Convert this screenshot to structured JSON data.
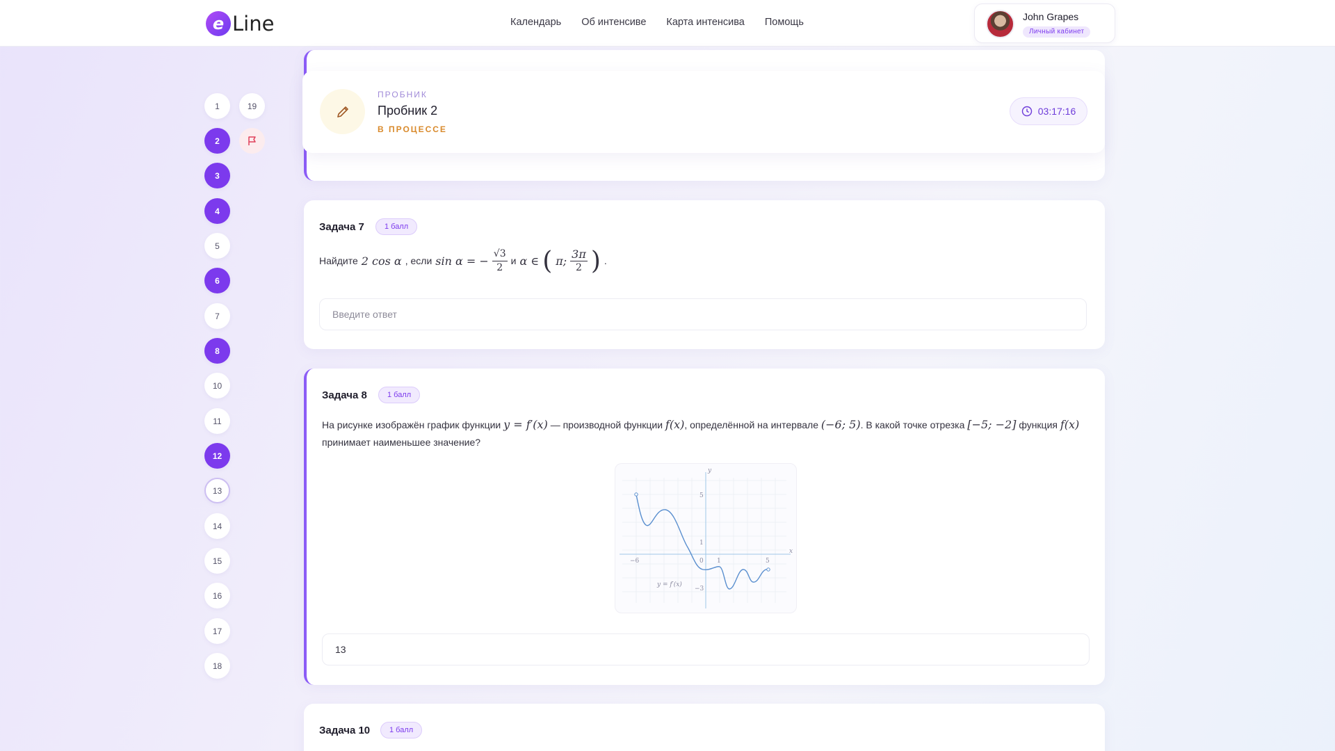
{
  "header": {
    "logo_text": "Line",
    "logo_mark": "e",
    "nav": [
      "Календарь",
      "Об интенсиве",
      "Карта интенсива",
      "Помощь"
    ],
    "user": {
      "name": "John Grapes",
      "badge": "Личный кабинет"
    }
  },
  "sidebar": {
    "questions": [
      {
        "label": "1",
        "state": "empty"
      },
      {
        "label": "19",
        "state": "empty"
      },
      {
        "label": "2",
        "state": "answered"
      },
      {
        "label": "3",
        "state": "answered"
      },
      {
        "label": "4",
        "state": "answered"
      },
      {
        "label": "5",
        "state": "empty"
      },
      {
        "label": "6",
        "state": "answered"
      },
      {
        "label": "7",
        "state": "empty"
      },
      {
        "label": "8",
        "state": "answered"
      },
      {
        "label": "10",
        "state": "empty"
      },
      {
        "label": "11",
        "state": "empty"
      },
      {
        "label": "12",
        "state": "answered"
      },
      {
        "label": "13",
        "state": "current"
      },
      {
        "label": "14",
        "state": "empty"
      },
      {
        "label": "15",
        "state": "empty"
      },
      {
        "label": "16",
        "state": "empty"
      },
      {
        "label": "17",
        "state": "empty"
      },
      {
        "label": "18",
        "state": "empty"
      }
    ],
    "flag_icon": "flag-icon"
  },
  "test": {
    "kind": "ПРОБНИК",
    "name": "Пробник 2",
    "status": "В ПРОЦЕССЕ",
    "timer": "03:17:16"
  },
  "tasks": [
    {
      "title": "Задача 7",
      "points": "1 балл",
      "text_find": "Найдите",
      "expr_a": "2 cos α",
      "text_if": ", если",
      "expr_b": "sin α = −",
      "frac_num": "√3",
      "frac_den": "2",
      "text_and": "и",
      "expr_c": "α ∈",
      "interval_left": "π;",
      "frac2_num": "3π",
      "frac2_den": "2",
      "answer_placeholder": "Введите ответ",
      "answer_value": ""
    },
    {
      "title": "Задача 8",
      "points": "1 балл",
      "text_1": "На рисунке изображён график функции",
      "m1": "y = f′(x)",
      "text_2": "— производной функции",
      "m2": "f(x)",
      "text_3": ", определённой на интервале",
      "m3": "(−6; 5)",
      "text_4": ". В какой точке отрезка",
      "m4": "[−5; −2]",
      "text_5": "функция",
      "m5": "f(x)",
      "text_6": "принимает наименьшее значение?",
      "answer_value": "13",
      "graph": {
        "axis_x": "x",
        "axis_y": "y",
        "tick_x": [
          "−6",
          "0",
          "1",
          "5"
        ],
        "tick_y": [
          "5",
          "1",
          "−3"
        ],
        "curve_label": "y = f′(x)"
      }
    },
    {
      "title": "Задача 10",
      "points": "1 балл"
    }
  ]
}
